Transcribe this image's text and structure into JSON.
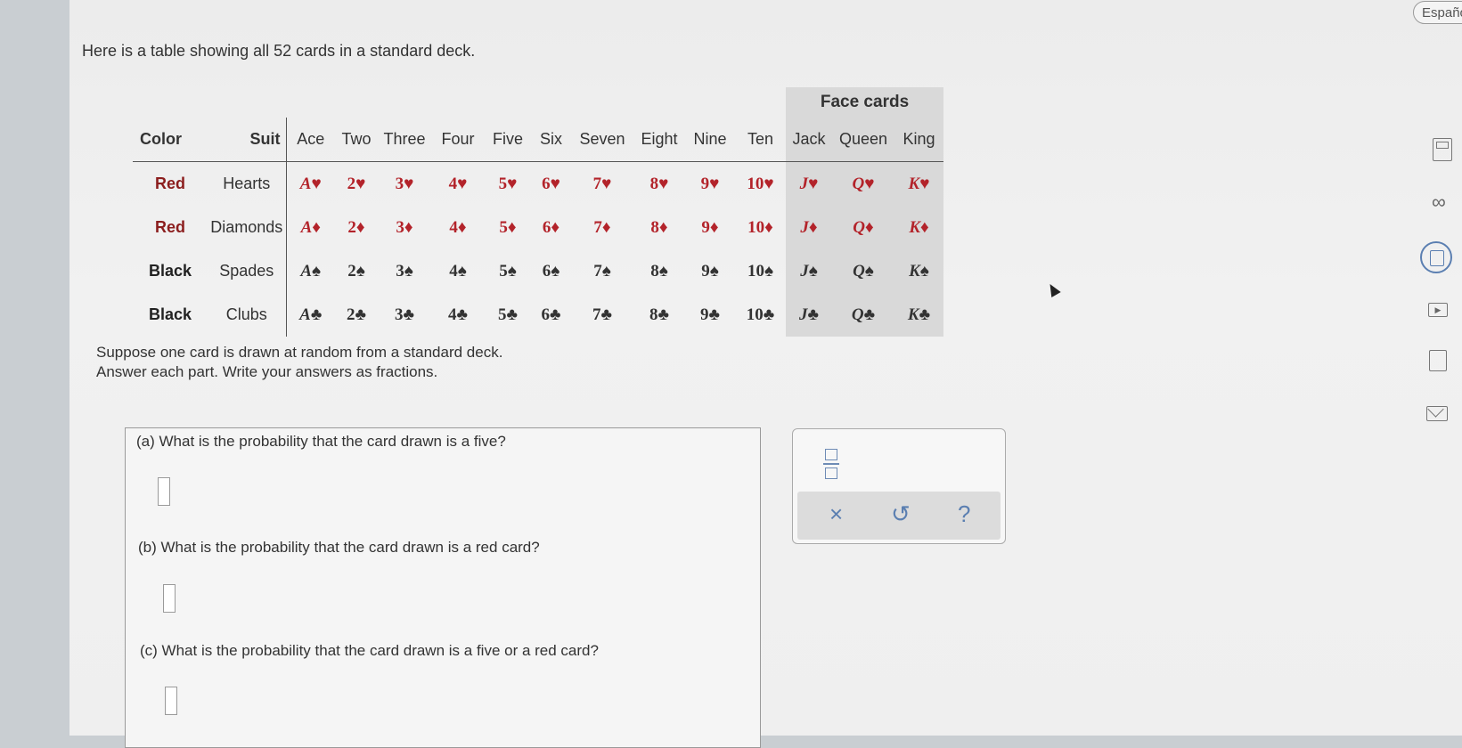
{
  "language_button": "Españo",
  "intro": "Here is a table showing all 52 cards in a standard deck.",
  "table": {
    "face_cards_header": "Face cards",
    "color_header": "Color",
    "suit_header": "Suit",
    "rank_headers": [
      "Ace",
      "Two",
      "Three",
      "Four",
      "Five",
      "Six",
      "Seven",
      "Eight",
      "Nine",
      "Ten",
      "Jack",
      "Queen",
      "King"
    ],
    "rows": [
      {
        "color": "Red",
        "suit": "Hearts",
        "tone": "red",
        "cards": [
          "A♥",
          "2♥",
          "3♥",
          "4♥",
          "5♥",
          "6♥",
          "7♥",
          "8♥",
          "9♥",
          "10♥",
          "J♥",
          "Q♥",
          "K♥"
        ]
      },
      {
        "color": "Red",
        "suit": "Diamonds",
        "tone": "red",
        "cards": [
          "A♦",
          "2♦",
          "3♦",
          "4♦",
          "5♦",
          "6♦",
          "7♦",
          "8♦",
          "9♦",
          "10♦",
          "J♦",
          "Q♦",
          "K♦"
        ]
      },
      {
        "color": "Black",
        "suit": "Spades",
        "tone": "blk",
        "cards": [
          "A♠",
          "2♠",
          "3♠",
          "4♠",
          "5♠",
          "6♠",
          "7♠",
          "8♠",
          "9♠",
          "10♠",
          "J♠",
          "Q♠",
          "K♠"
        ]
      },
      {
        "color": "Black",
        "suit": "Clubs",
        "tone": "blk",
        "cards": [
          "A♣",
          "2♣",
          "3♣",
          "4♣",
          "5♣",
          "6♣",
          "7♣",
          "8♣",
          "9♣",
          "10♣",
          "J♣",
          "Q♣",
          "K♣"
        ]
      }
    ]
  },
  "prompt_line1": "Suppose one card is drawn at random from a standard deck.",
  "prompt_line2": "Answer each part. Write your answers as fractions.",
  "questions": {
    "a": "(a) What is the probability that the card drawn is a five?",
    "b": "(b) What is the probability that the card drawn is a red card?",
    "c": "(c) What is the probability that the card drawn is a five or a red card?"
  },
  "toolbar": {
    "clear": "×",
    "undo": "↺",
    "help": "?"
  },
  "side_icons": [
    "calculator-icon",
    "infinity-icon",
    "document-icon",
    "video-icon",
    "calendar-icon",
    "mail-icon"
  ],
  "colors": {
    "red": "#b3232a",
    "accent": "#5b7fb1"
  }
}
